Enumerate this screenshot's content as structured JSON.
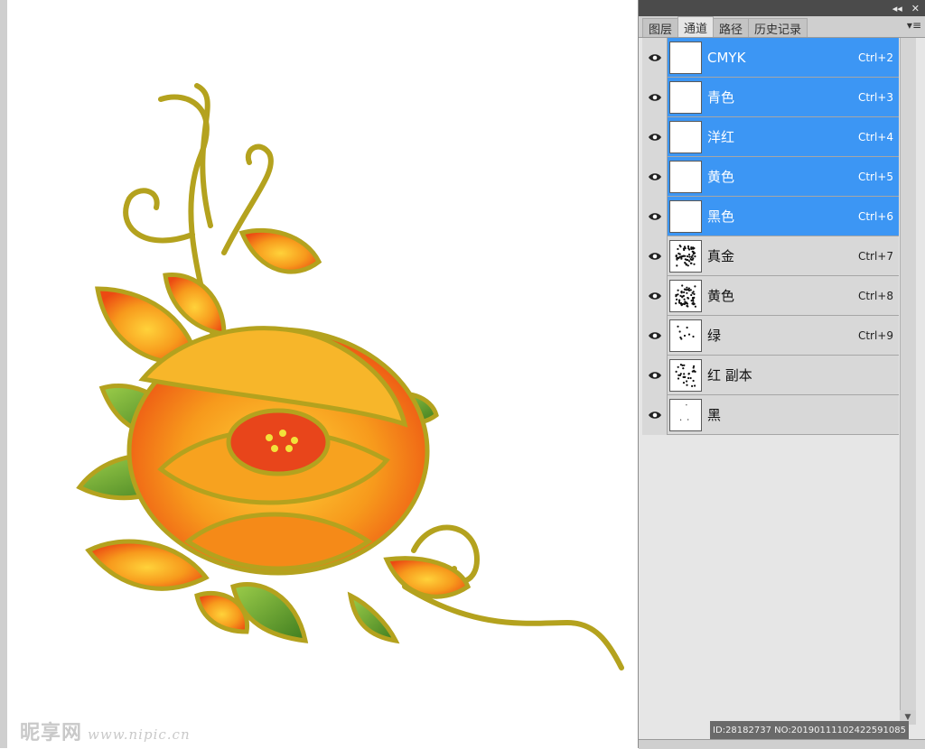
{
  "panel": {
    "collapse_icon": "double-arrow-icon",
    "close_label": "✕",
    "menu_icon": "panel-menu-icon",
    "tabs": [
      {
        "label": "图层",
        "active": false
      },
      {
        "label": "通道",
        "active": true
      },
      {
        "label": "路径",
        "active": false
      },
      {
        "label": "历史记录",
        "active": false
      }
    ],
    "channels": [
      {
        "name": "CMYK",
        "shortcut": "Ctrl+2",
        "selected": true,
        "thumb": "blank"
      },
      {
        "name": "青色",
        "shortcut": "Ctrl+3",
        "selected": true,
        "thumb": "blank"
      },
      {
        "name": "洋红",
        "shortcut": "Ctrl+4",
        "selected": true,
        "thumb": "blank"
      },
      {
        "name": "黄色",
        "shortcut": "Ctrl+5",
        "selected": true,
        "thumb": "blank"
      },
      {
        "name": "黑色",
        "shortcut": "Ctrl+6",
        "selected": true,
        "thumb": "blank"
      },
      {
        "name": "真金",
        "shortcut": "Ctrl+7",
        "selected": false,
        "thumb": "dense"
      },
      {
        "name": "黄色",
        "shortcut": "Ctrl+8",
        "selected": false,
        "thumb": "dense"
      },
      {
        "name": "绿",
        "shortcut": "Ctrl+9",
        "selected": false,
        "thumb": "sparse"
      },
      {
        "name": "红 副本",
        "shortcut": "",
        "selected": false,
        "thumb": "medium"
      },
      {
        "name": "黑",
        "shortcut": "",
        "selected": false,
        "thumb": "faint"
      }
    ],
    "id_text": "ID:28182737 NO:20190111102422591085"
  },
  "watermark": {
    "brand": "昵享网",
    "url": "www.nipic.cn"
  },
  "colors": {
    "selected_row": "#3c96f4",
    "petal_orange": "#f79a1c",
    "petal_red": "#ec4a12",
    "outline_gold": "#b4a21e",
    "leaf_green": "#5d9a2c"
  }
}
